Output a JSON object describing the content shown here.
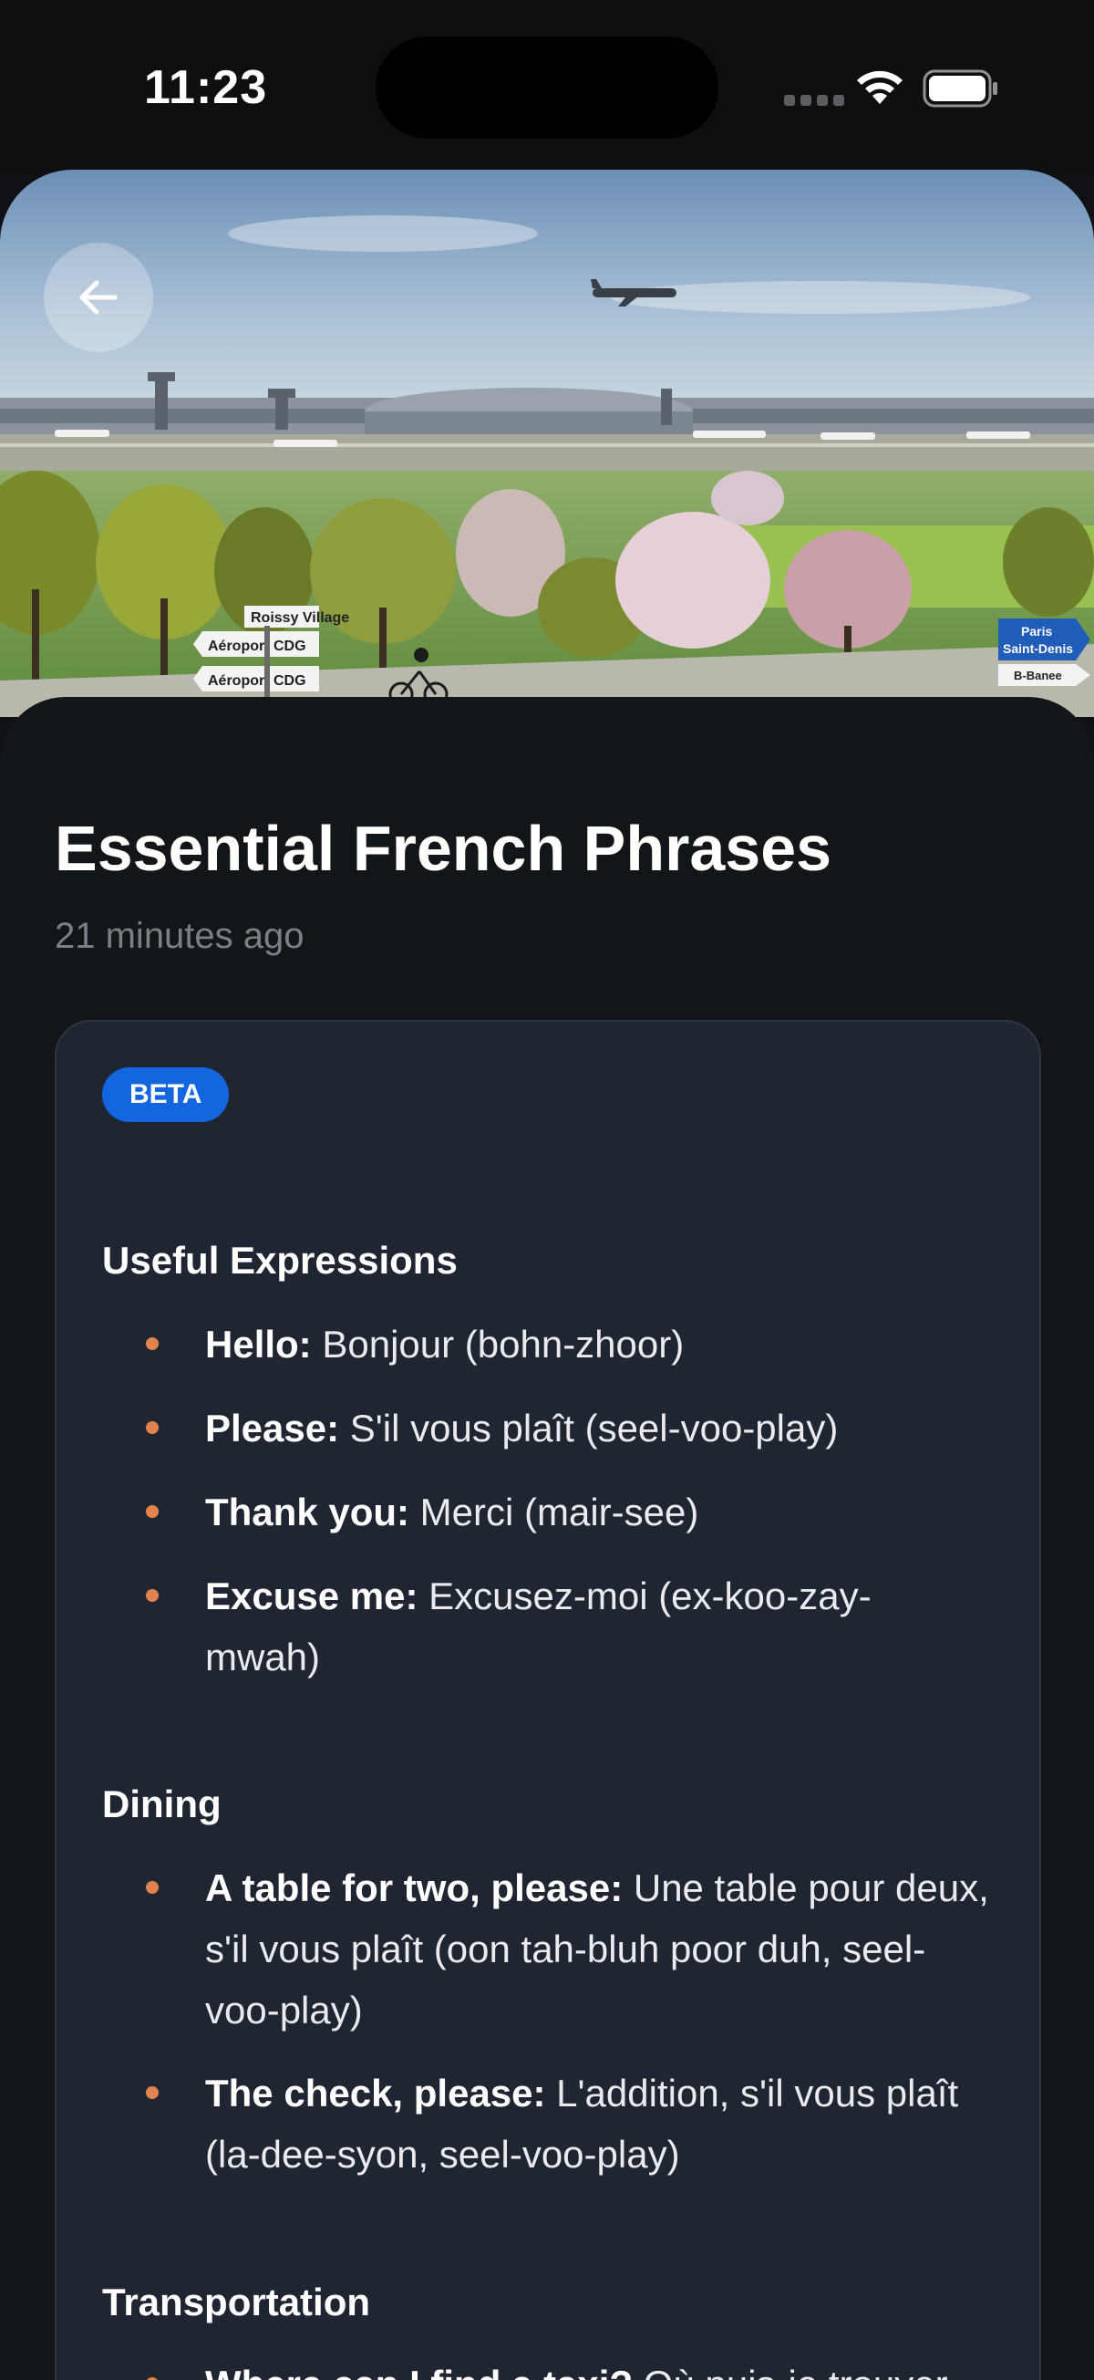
{
  "status_bar": {
    "time": "11:23"
  },
  "article": {
    "title": "Essential French Phrases",
    "timestamp": "21 minutes ago",
    "badge": "BETA",
    "hero_sign_texts": {
      "sign_1": "Roissy Village",
      "sign_2": "Aéroport CDG",
      "sign_3": "Aéroport CDG",
      "sign_4": "Paris",
      "sign_5": "Saint-Denis",
      "sign_6": "B-Banee"
    }
  },
  "sections": [
    {
      "title": "Useful Expressions",
      "items": [
        {
          "term": "Hello:",
          "translation": " Bonjour (bohn-zhoor)"
        },
        {
          "term": "Please:",
          "translation": " S'il vous plaît (seel-voo-play)"
        },
        {
          "term": "Thank you:",
          "translation": " Merci (mair-see)"
        },
        {
          "term": "Excuse me:",
          "translation": " Excusez-moi (ex-koo-zay-mwah)"
        }
      ]
    },
    {
      "title": "Dining",
      "items": [
        {
          "term": "A table for two, please:",
          "translation": " Une table pour deux, s'il vous plaît (oon tah-bluh poor duh, seel-voo-play)"
        },
        {
          "term": "The check, please:",
          "translation": " L'addition, s'il vous plaît (la-dee-syon, seel-voo-play)"
        }
      ]
    },
    {
      "title": "Transportation",
      "items": [
        {
          "term": "Where can I find a taxi?",
          "translation": " Où puis-je trouver"
        }
      ]
    }
  ],
  "colors": {
    "background": "#0f1114",
    "card": "#1f2631",
    "badge": "#1466e0",
    "bullet": "#e0834f",
    "muted_text": "#7b7f86"
  },
  "icons": {
    "back": "arrow-left-icon",
    "wifi": "wifi-icon",
    "battery": "battery-icon",
    "signal": "cellular-signal-icon"
  }
}
